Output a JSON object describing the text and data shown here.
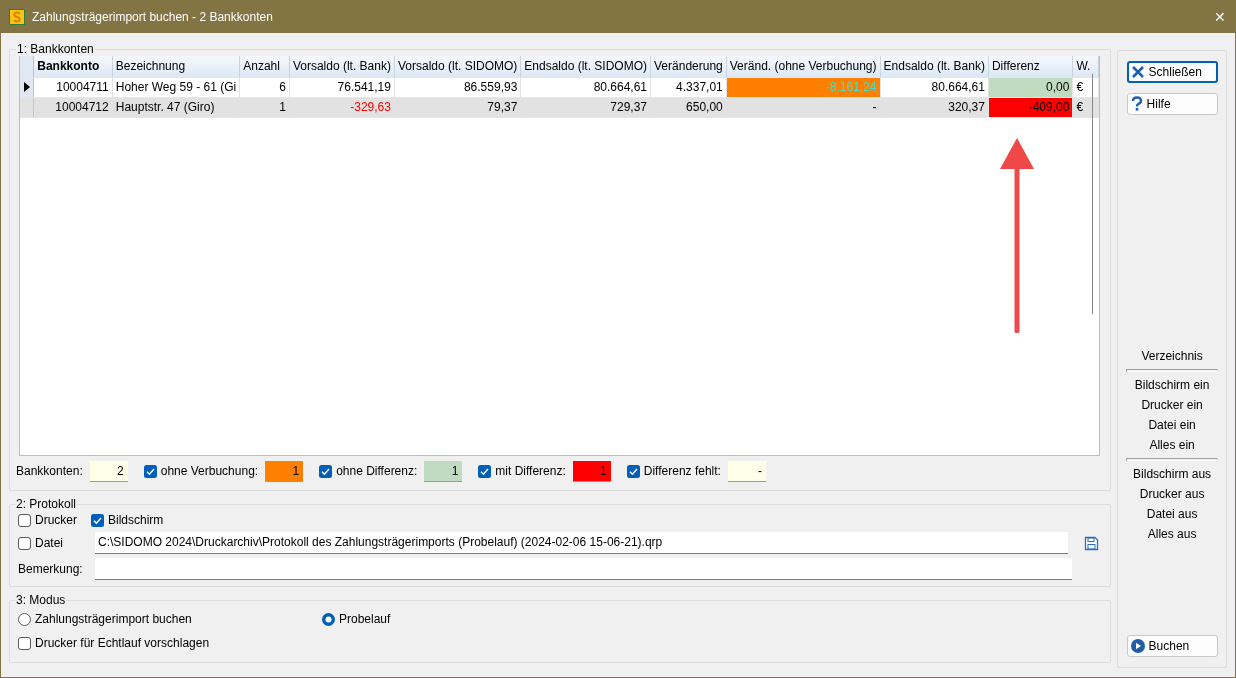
{
  "window": {
    "title": "Zahlungsträgerimport buchen - 2 Bankkonten",
    "close": "✕"
  },
  "bankkonten": {
    "legend": "1: Bankkonten",
    "columns": [
      {
        "label": "Bankkonto",
        "bold": true,
        "kind": "number"
      },
      {
        "label": "Bezeichnung",
        "bold": false,
        "kind": "text"
      },
      {
        "label": "Anzahl",
        "bold": false,
        "kind": "number"
      },
      {
        "label": "Vorsaldo (lt. Bank)",
        "bold": false,
        "kind": "number"
      },
      {
        "label": "Vorsaldo (lt. SIDOMO)",
        "bold": false,
        "kind": "number"
      },
      {
        "label": "Endsaldo (lt. SIDOMO)",
        "bold": false,
        "kind": "number"
      },
      {
        "label": "Veränderung",
        "bold": false,
        "kind": "number"
      },
      {
        "label": "Veränd. (ohne Verbuchung)",
        "bold": false,
        "kind": "number"
      },
      {
        "label": "Endsaldo (lt. Bank)",
        "bold": false,
        "kind": "number"
      },
      {
        "label": "Differenz",
        "bold": false,
        "kind": "number"
      },
      {
        "label": "W.",
        "bold": false,
        "kind": "text"
      }
    ],
    "rows": [
      {
        "current": true,
        "cells": [
          {
            "text": "10004711"
          },
          {
            "text": "Hoher Weg 59 - 61 (Gi"
          },
          {
            "text": "6"
          },
          {
            "text": "76.541,19"
          },
          {
            "text": "86.559,93"
          },
          {
            "text": "80.664,61"
          },
          {
            "text": "4.337,01"
          },
          {
            "text": "-8.161,24",
            "color": "#ff8000",
            "font": {
              "color": "#40e0c8"
            }
          },
          {
            "text": "80.664,61"
          },
          {
            "text": "0,00",
            "color": "#c0dcc0"
          },
          {
            "text": "€"
          }
        ]
      },
      {
        "current": false,
        "cells": [
          {
            "text": "10004712"
          },
          {
            "text": "Hauptstr. 47 (Giro)"
          },
          {
            "text": "1"
          },
          {
            "text": "-329,63",
            "font": {
              "color": "#ff0000"
            }
          },
          {
            "text": "79,37"
          },
          {
            "text": "729,37"
          },
          {
            "text": "650,00"
          },
          {
            "text": "-"
          },
          {
            "text": "320,37"
          },
          {
            "text": "-409,00",
            "color": "#ff0000"
          },
          {
            "text": "€"
          }
        ]
      }
    ],
    "summary": [
      {
        "kind": "count",
        "label": "Bankkonten:",
        "value": "2",
        "color": "#ffffe8"
      },
      {
        "kind": "filter",
        "checked": true,
        "label": "ohne Verbuchung:",
        "value": "1",
        "color": "#ff8000"
      },
      {
        "kind": "filter",
        "checked": true,
        "label": "ohne Differenz:",
        "value": "1",
        "color": "#c0dcc0"
      },
      {
        "kind": "filter",
        "checked": true,
        "label": "mit Differenz:",
        "value": "1",
        "color": "#ff0000"
      },
      {
        "kind": "filter",
        "checked": true,
        "label": "Differenz fehlt:",
        "value": "-",
        "color": "#ffffe8"
      }
    ]
  },
  "protokoll": {
    "legend": "2: Protokoll",
    "outputs": [
      {
        "label": "Drucker",
        "checked": false
      },
      {
        "label": "Bildschirm",
        "checked": true
      }
    ],
    "datei": {
      "label": "Datei",
      "checked": false,
      "value": "C:\\SIDOMO 2024\\Druckarchiv\\Protokoll des Zahlungsträgerimports  (Probelauf) (2024-02-06 15-06-21).qrp"
    },
    "bemerkung": {
      "label": "Bemerkung:"
    }
  },
  "modus": {
    "legend": "3: Modus",
    "options": [
      {
        "label": "Zahlungsträgerimport buchen",
        "selected": false
      },
      {
        "label": "Probelauf",
        "selected": true
      }
    ],
    "echtlauf": {
      "label": "Drucker für Echtlauf vorschlagen",
      "checked": false
    }
  },
  "side": {
    "buttons": [
      {
        "label": "Schließen",
        "kind": "close"
      },
      {
        "label": "Hilfe",
        "kind": "help"
      }
    ],
    "links": [
      {
        "kind": "heading",
        "label": "Verzeichnis"
      },
      {
        "kind": "separator"
      },
      {
        "kind": "link",
        "label": "Bildschirm ein"
      },
      {
        "kind": "link",
        "label": "Drucker ein"
      },
      {
        "kind": "link",
        "label": "Datei ein"
      },
      {
        "kind": "link",
        "label": "Alles ein"
      },
      {
        "kind": "separator"
      },
      {
        "kind": "link",
        "label": "Bildschirm aus"
      },
      {
        "kind": "link",
        "label": "Drucker aus"
      },
      {
        "kind": "link",
        "label": "Datei aus"
      },
      {
        "kind": "link",
        "label": "Alles aus"
      }
    ],
    "action": {
      "label": "Buchen"
    }
  }
}
